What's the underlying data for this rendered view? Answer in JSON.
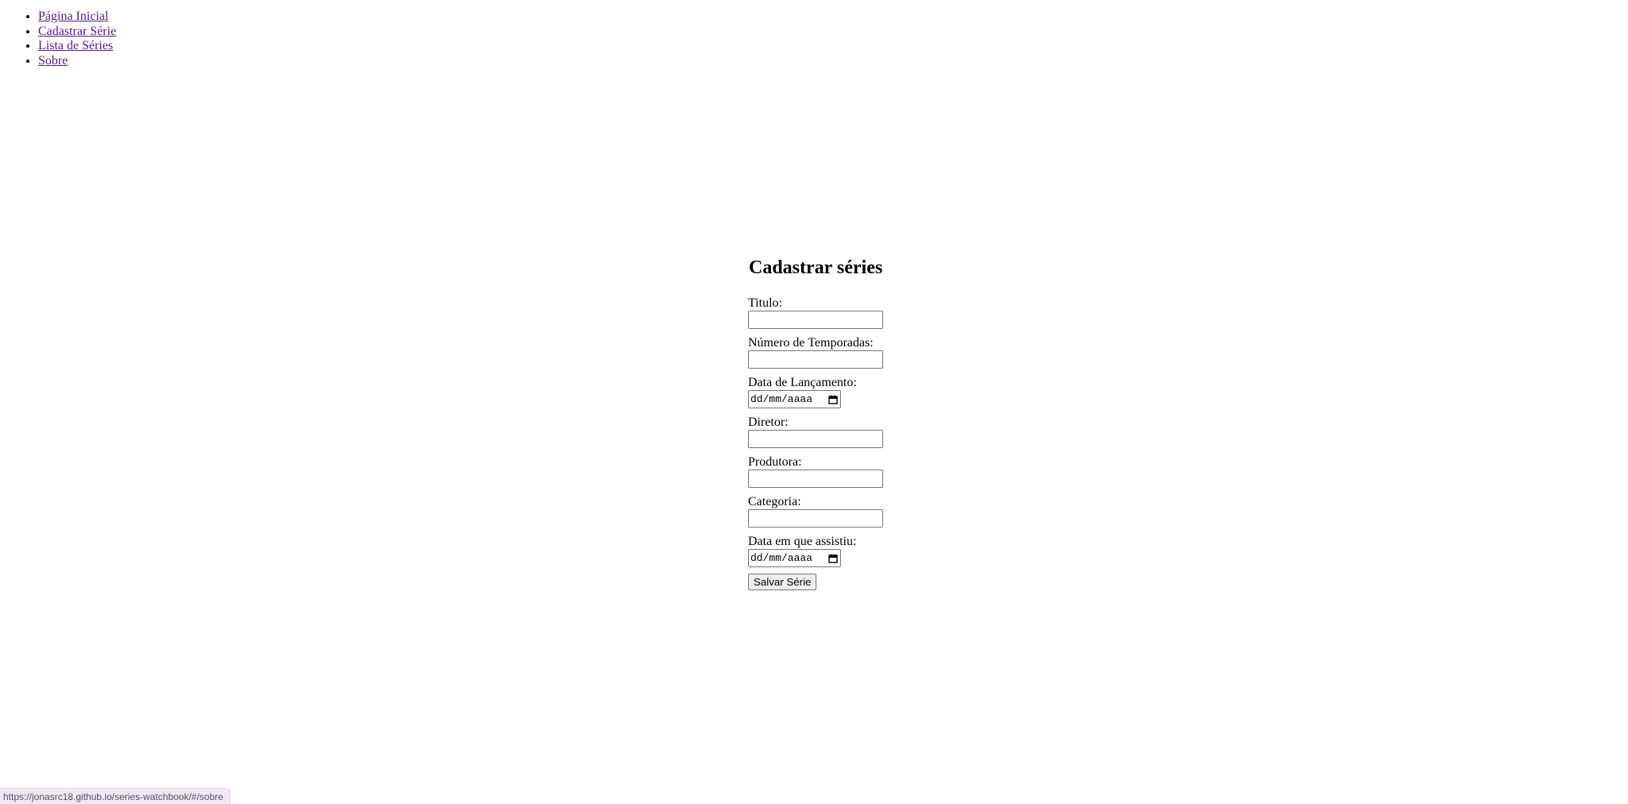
{
  "nav": {
    "items": [
      {
        "label": "Página Inicial"
      },
      {
        "label": "Cadastrar Série"
      },
      {
        "label": "Lista de Séries"
      },
      {
        "label": "Sobre"
      }
    ]
  },
  "form": {
    "title": "Cadastrar séries",
    "fields": {
      "titulo": {
        "label": "Titulo:",
        "value": ""
      },
      "temporadas": {
        "label": "Número de Temporadas:",
        "value": ""
      },
      "lancamento": {
        "label": "Data de Lançamento:",
        "placeholder": "dd/mm/aaaa"
      },
      "diretor": {
        "label": "Diretor:",
        "value": ""
      },
      "produtora": {
        "label": "Produtora:",
        "value": ""
      },
      "categoria": {
        "label": "Categoria:",
        "value": ""
      },
      "assistiu": {
        "label": "Data em que assistiu:",
        "placeholder": "dd/mm/aaaa"
      }
    },
    "submit_label": "Salvar Série"
  },
  "status_bar": {
    "url": "https://jonasrc18.github.io/series-watchbook/#/sobre"
  },
  "icons": {
    "date_picker": "calendar-icon"
  },
  "colors": {
    "link": "#551a8b",
    "status_bar_bg": "#f2e7f7"
  }
}
